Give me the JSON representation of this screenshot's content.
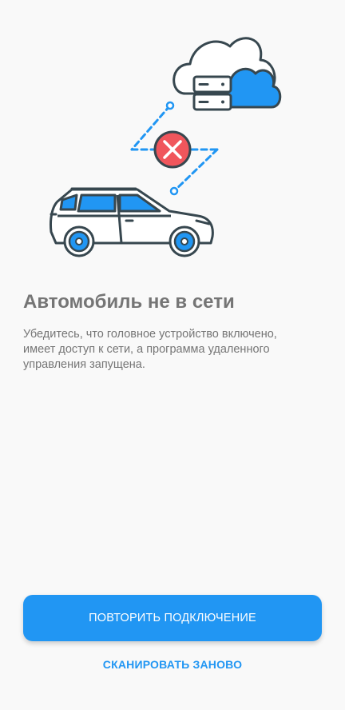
{
  "status": {
    "title": "Автомобиль не в сети",
    "description": "Убедитесь, что головное устройство включено, имеет доступ к сети, а программа удаленного управления запущена."
  },
  "actions": {
    "retry_label": "ПОВТОРИТЬ ПОДКЛЮЧЕНИЕ",
    "rescan_label": "СКАНИРОВАТЬ ЗАНОВО"
  },
  "illustration": {
    "icons": [
      "cloud-server-icon",
      "disconnected-x-icon",
      "car-icon"
    ]
  },
  "colors": {
    "accent": "#2196f3",
    "error": "#f0565c",
    "outline": "#37474f",
    "text": "#757575",
    "background": "#f9f9f9"
  }
}
